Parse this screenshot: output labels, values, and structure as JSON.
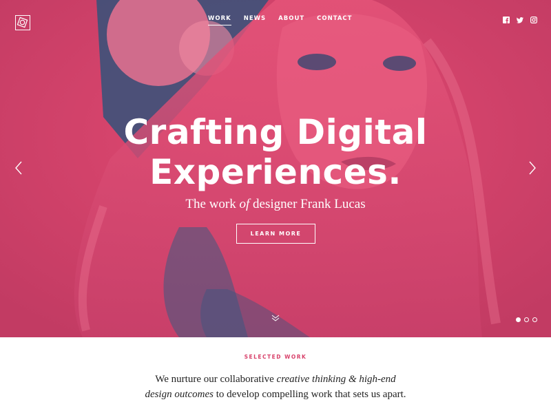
{
  "colors": {
    "accent": "#d8416a",
    "hero_dark": "#2a4a6e",
    "text": "#222222"
  },
  "brand": {
    "logo_icon": "square-circle-logo"
  },
  "nav": {
    "items": [
      {
        "label": "WORK",
        "active": true
      },
      {
        "label": "NEWS",
        "active": false
      },
      {
        "label": "ABOUT",
        "active": false
      },
      {
        "label": "CONTACT",
        "active": false
      }
    ]
  },
  "social": {
    "icons": [
      "facebook-icon",
      "twitter-icon",
      "instagram-icon"
    ]
  },
  "hero": {
    "title_line1": "Crafting Digital",
    "title_line2": "Experiences.",
    "subtitle_pre": "The work",
    "subtitle_em": "of",
    "subtitle_post": "designer Frank Lucas",
    "cta_label": "LEARN MORE",
    "slides_total": 3,
    "slide_active": 1
  },
  "section": {
    "label": "SELECTED WORK",
    "line1_pre": "We nurture our collaborative",
    "line1_em": "creative thinking & high-end",
    "line2_em": "design outcomes",
    "line2_post": "to develop compelling work that sets us apart."
  }
}
